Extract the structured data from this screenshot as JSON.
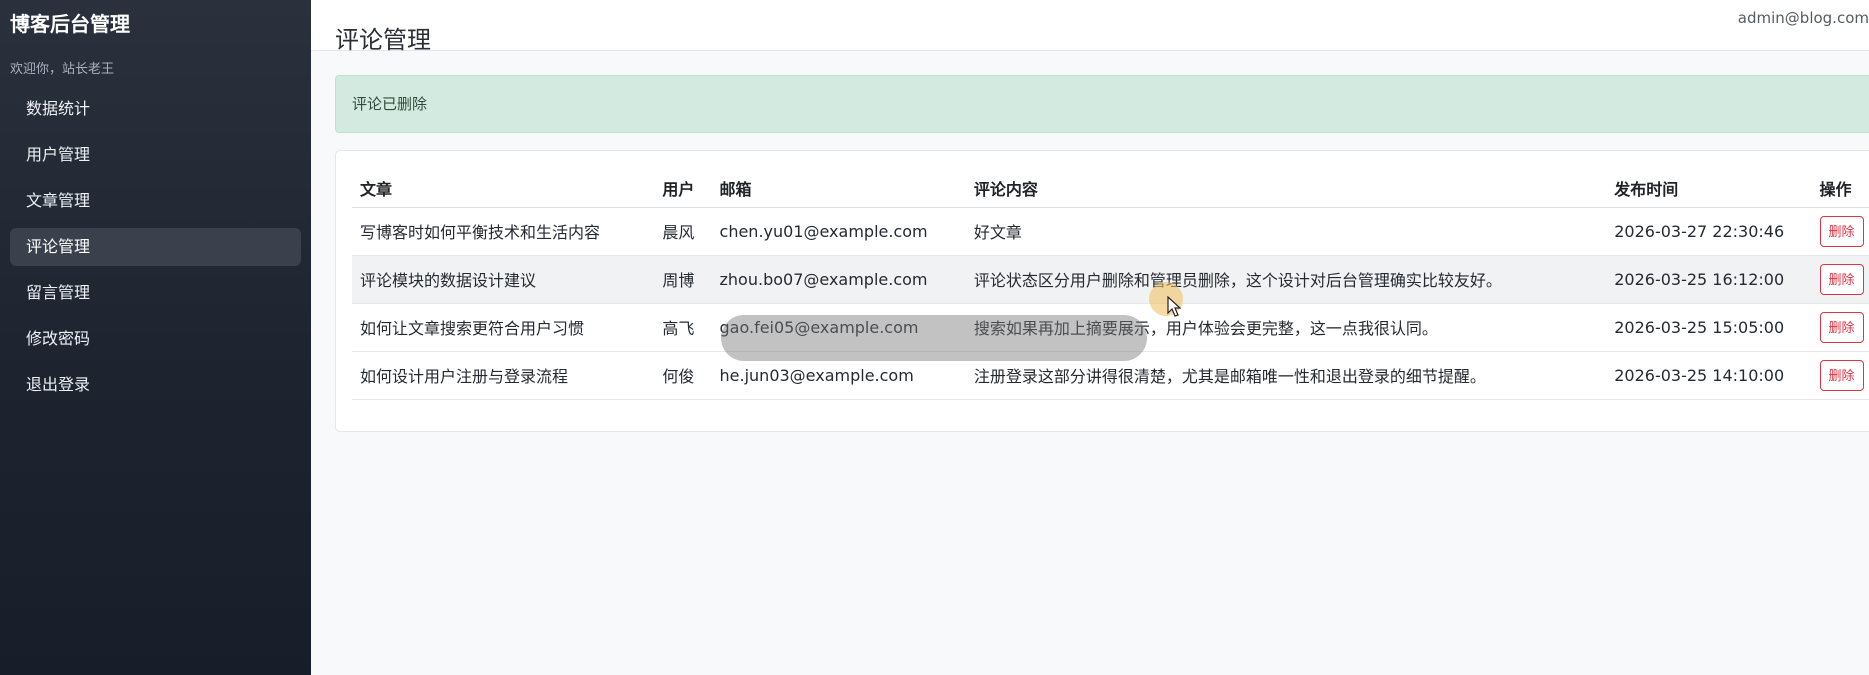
{
  "sidebar": {
    "brand": "博客后台管理",
    "welcome": "欢迎你，站长老王",
    "items": [
      {
        "label": "数据统计"
      },
      {
        "label": "用户管理"
      },
      {
        "label": "文章管理"
      },
      {
        "label": "评论管理",
        "active": true
      },
      {
        "label": "留言管理"
      },
      {
        "label": "修改密码"
      },
      {
        "label": "退出登录"
      }
    ]
  },
  "header": {
    "title": "评论管理",
    "user_email": "admin@blog.com"
  },
  "alert": {
    "message": "评论已删除",
    "color": "#d2eadf"
  },
  "table": {
    "columns": [
      "文章",
      "用户",
      "邮箱",
      "评论内容",
      "发布时间",
      "操作"
    ],
    "rows": [
      {
        "article": "写博客时如何平衡技术和生活内容",
        "user": "晨风",
        "email": "chen.yu01@example.com",
        "content": "好文章",
        "time": "2026-03-27 22:30:46",
        "action": "删除"
      },
      {
        "article": "评论模块的数据设计建议",
        "user": "周博",
        "email": "zhou.bo07@example.com",
        "content": "评论状态区分用户删除和管理员删除，这个设计对后台管理确实比较友好。",
        "time": "2026-03-25 16:12:00",
        "action": "删除"
      },
      {
        "article": "如何让文章搜索更符合用户习惯",
        "user": "高飞",
        "email": "gao.fei05@example.com",
        "content": "搜索如果再加上摘要展示，用户体验会更完整，这一点我很认同。",
        "time": "2026-03-25 15:05:00",
        "action": "删除"
      },
      {
        "article": "如何设计用户注册与登录流程",
        "user": "何俊",
        "email": "he.jun03@example.com",
        "content": "注册登录这部分讲得很清楚，尤其是邮箱唯一性和退出登录的细节提醒。",
        "time": "2026-03-25 14:10:00",
        "action": "删除"
      }
    ]
  },
  "colors": {
    "sidebar_bg": "#1d2430",
    "sidebar_active": "#3a414c",
    "danger": "#dc3545"
  }
}
